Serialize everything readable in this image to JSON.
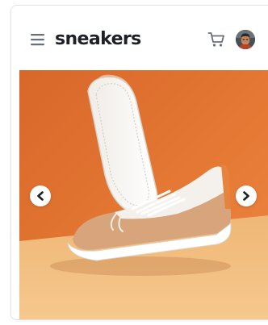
{
  "header": {
    "brand": "sneakers",
    "menu_icon": "hamburger-menu-icon",
    "cart_icon": "shopping-cart-icon",
    "avatar": "user-avatar"
  },
  "gallery": {
    "image": "sneaker-product-photo",
    "prev_icon": "chevron-left-icon",
    "next_icon": "chevron-right-icon"
  },
  "colors": {
    "brand_text": "#1d2026",
    "icon": "#69707d",
    "background_orange": "#e07834",
    "floor_peach": "#f2bf80"
  }
}
